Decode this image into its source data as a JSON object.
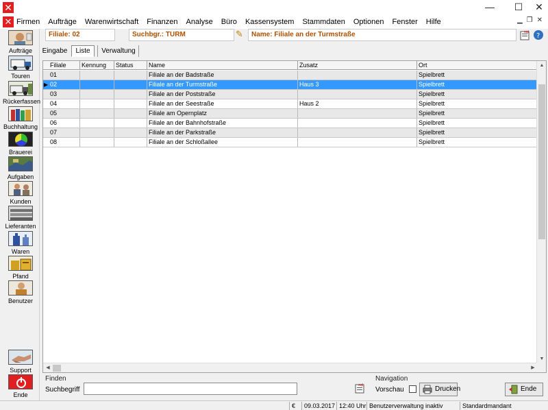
{
  "window": {
    "controls": {
      "minimize": "—",
      "maximize": "☐",
      "close": "✕"
    }
  },
  "menu": {
    "items": [
      "Firmen",
      "Aufträge",
      "Warenwirtschaft",
      "Finanzen",
      "Analyse",
      "Büro",
      "Kassensystem",
      "Stammdaten",
      "Optionen",
      "Fenster",
      "Hilfe"
    ]
  },
  "sidebar": {
    "items": [
      {
        "label": "Aufträge",
        "icon": "person-icon"
      },
      {
        "label": "Touren",
        "icon": "truck-icon"
      },
      {
        "label": "Rückerfassen",
        "icon": "truck-return-icon"
      },
      {
        "label": "Buchhaltung",
        "icon": "books-icon"
      },
      {
        "label": "Brauerei",
        "icon": "color-wheel-icon"
      },
      {
        "label": "Aufgaben",
        "icon": "map-icon"
      },
      {
        "label": "Kunden",
        "icon": "customers-icon"
      },
      {
        "label": "Lieferanten",
        "icon": "warehouse-icon"
      },
      {
        "label": "Waren",
        "icon": "bottles-icon"
      },
      {
        "label": "Pfand",
        "icon": "crates-icon"
      },
      {
        "label": "Benutzer",
        "icon": "user-icon"
      }
    ],
    "support_label": "Support",
    "exit_label": "Ende"
  },
  "header": {
    "filiale": "Filiale: 02",
    "suchbegriff": "Suchbgr.: TURM",
    "name": "Name: Filiale an der Turmstraße"
  },
  "tabs": [
    "Eingabe",
    "Liste",
    "Verwaltung"
  ],
  "grid": {
    "columns": [
      "Filiale",
      "Kennung",
      "Status",
      "Name",
      "Zusatz",
      "Ort"
    ],
    "rows": [
      {
        "filiale": "01",
        "kennung": "",
        "status": "",
        "name": "Filiale an der Badstraße",
        "zusatz": "",
        "ort": "Spielbrett"
      },
      {
        "filiale": "02",
        "kennung": "",
        "status": "",
        "name": "Filiale an der Turmstraße",
        "zusatz": "Haus 3",
        "ort": "Spielbrett"
      },
      {
        "filiale": "03",
        "kennung": "",
        "status": "",
        "name": "Filiale an der Poststraße",
        "zusatz": "",
        "ort": "Spielbrett"
      },
      {
        "filiale": "04",
        "kennung": "",
        "status": "",
        "name": "Filiale an der Seestraße",
        "zusatz": "Haus 2",
        "ort": "Spielbrett"
      },
      {
        "filiale": "05",
        "kennung": "",
        "status": "",
        "name": "Filiale am Opernplatz",
        "zusatz": "",
        "ort": "Spielbrett"
      },
      {
        "filiale": "06",
        "kennung": "",
        "status": "",
        "name": "Filiale an der Bahnhofstraße",
        "zusatz": "",
        "ort": "Spielbrett"
      },
      {
        "filiale": "07",
        "kennung": "",
        "status": "",
        "name": "Filiale an der Parkstraße",
        "zusatz": "",
        "ort": "Spielbrett"
      },
      {
        "filiale": "08",
        "kennung": "",
        "status": "",
        "name": "Filiale an der Schloßallee",
        "zusatz": "",
        "ort": "Spielbrett"
      }
    ]
  },
  "find": {
    "group_label": "Finden",
    "search_label": "Suchbegriff",
    "search_value": ""
  },
  "navigation": {
    "group_label": "Navigation",
    "preview_label": "Vorschau",
    "print_label": "Drucken",
    "end_label": "Ende"
  },
  "status": {
    "currency": "€",
    "date": "09.03.2017",
    "time": "12:40 Uhr",
    "message": "Benutzerverwaltung inaktiv",
    "mandant": "Standardmandant"
  },
  "colors": {
    "accent_text": "#b05000",
    "selection": "#3399ff",
    "logo": "#e02020"
  }
}
